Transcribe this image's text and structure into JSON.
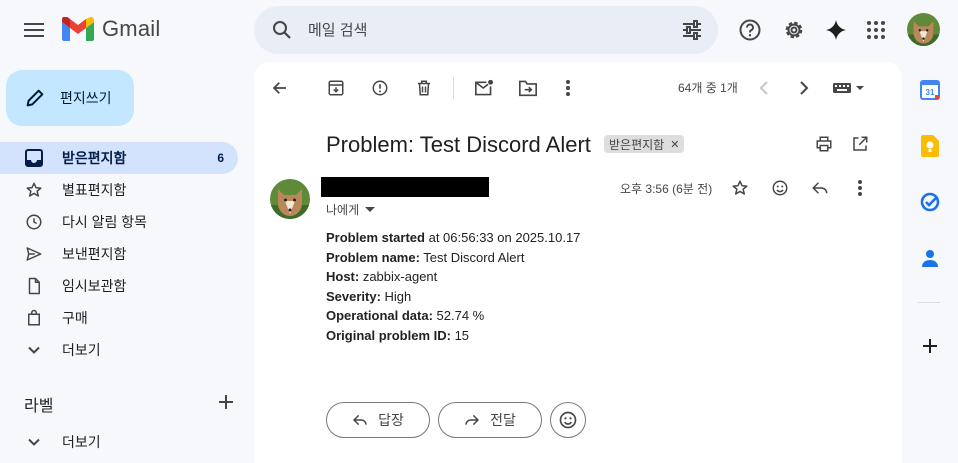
{
  "app": {
    "logo_text": "Gmail"
  },
  "search": {
    "placeholder": "메일 검색"
  },
  "compose": {
    "label": "편지쓰기"
  },
  "sidebar": {
    "items": [
      {
        "label": "받은편지함",
        "count": "6",
        "icon": "inbox-icon",
        "active": true
      },
      {
        "label": "별표편지함",
        "icon": "star-icon"
      },
      {
        "label": "다시 알림 항목",
        "icon": "clock-icon"
      },
      {
        "label": "보낸편지함",
        "icon": "send-icon"
      },
      {
        "label": "임시보관함",
        "icon": "draft-icon"
      },
      {
        "label": "구매",
        "icon": "shopping-bag-icon"
      },
      {
        "label": "더보기",
        "icon": "chevron-down-icon"
      }
    ],
    "labels_title": "라벨",
    "labels_more": "더보기"
  },
  "toolbar": {
    "pager": "64개 중 1개"
  },
  "email": {
    "subject": "Problem: Test Discord Alert",
    "label_chip": "받은편지함",
    "to": "나에게",
    "time": "오후 3:56 (6분 전)",
    "lines": [
      {
        "key": "Problem started",
        "value": " at 06:56:33 on 2025.10.17"
      },
      {
        "key": "Problem name:",
        "value": " Test Discord Alert"
      },
      {
        "key": "Host:",
        "value": " zabbix-agent"
      },
      {
        "key": "Severity:",
        "value": " High"
      },
      {
        "key": "Operational data:",
        "value": " 52.74 %"
      },
      {
        "key": "Original problem ID:",
        "value": " 15"
      }
    ]
  },
  "actions": {
    "reply": "답장",
    "forward": "전달"
  },
  "colors": {
    "accent": "#c2e7ff",
    "active_nav": "#d3e3fd",
    "background": "#f6f8fc"
  }
}
